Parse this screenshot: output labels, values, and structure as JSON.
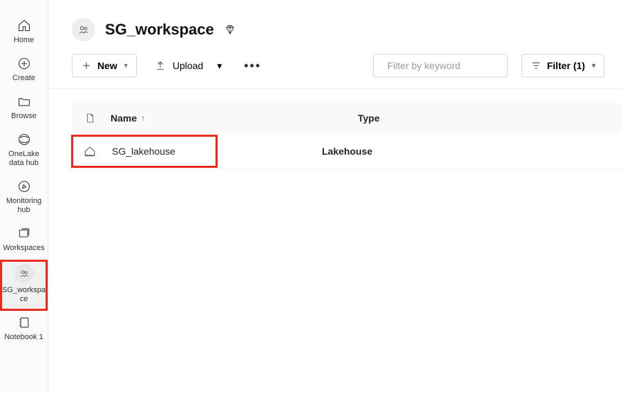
{
  "nav": {
    "items": [
      {
        "label": "Home"
      },
      {
        "label": "Create"
      },
      {
        "label": "Browse"
      },
      {
        "label": "OneLake data hub"
      },
      {
        "label": "Monitoring hub"
      },
      {
        "label": "Workspaces"
      },
      {
        "label": "SG_workspace"
      },
      {
        "label": "Notebook 1"
      }
    ],
    "selected_index": 6
  },
  "workspace": {
    "title": "SG_workspace"
  },
  "toolbar": {
    "new_label": "New",
    "upload_label": "Upload",
    "filter_label": "Filter (1)",
    "search_placeholder": "Filter by keyword"
  },
  "table": {
    "columns": {
      "name": "Name",
      "type": "Type"
    },
    "rows": [
      {
        "name": "SG_lakehouse",
        "type": "Lakehouse"
      }
    ]
  }
}
